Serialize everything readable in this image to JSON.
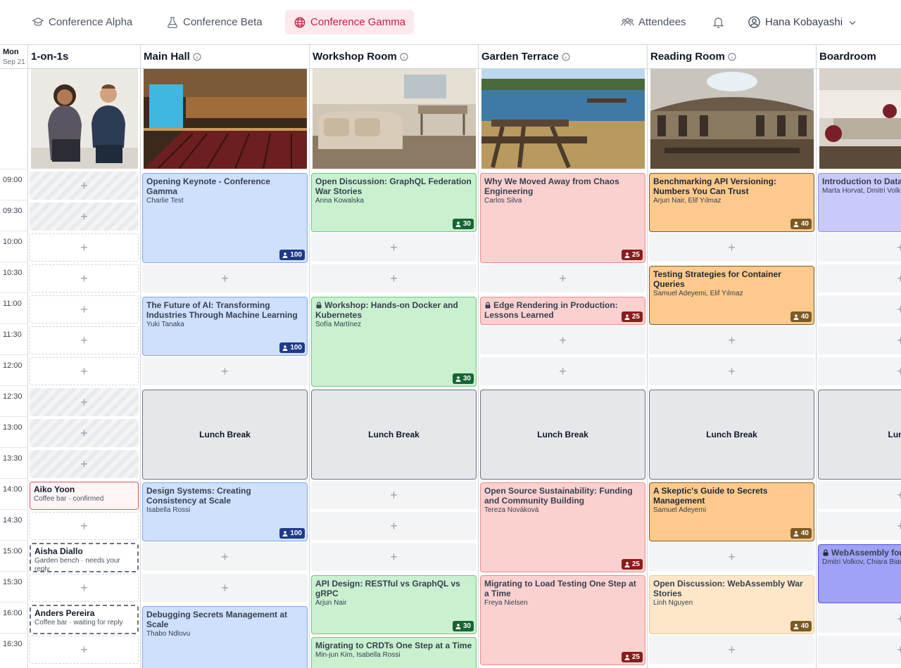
{
  "nav": {
    "tabs": [
      {
        "label": "Conference Alpha",
        "icon": "graduation-cap-icon"
      },
      {
        "label": "Conference Beta",
        "icon": "flask-icon"
      },
      {
        "label": "Conference Gamma",
        "icon": "globe-icon",
        "active": true
      }
    ],
    "attendees_label": "Attendees",
    "user_name": "Hana Kobayashi"
  },
  "date": {
    "dow": "Mon",
    "day": "Sep 21"
  },
  "times": [
    "09:00",
    "09:30",
    "10:00",
    "10:30",
    "11:00",
    "11:30",
    "12:00",
    "12:30",
    "13:00",
    "13:30",
    "14:00",
    "14:30",
    "15:00",
    "15:30",
    "16:00",
    "16:30"
  ],
  "columns": [
    {
      "name": "1-on-1s"
    },
    {
      "name": "Main Hall"
    },
    {
      "name": "Workshop Room"
    },
    {
      "name": "Garden Terrace"
    },
    {
      "name": "Reading Room"
    },
    {
      "name": "Boardroom"
    }
  ],
  "meetings": [
    {
      "name": "Aiko Yoon",
      "detail": "Coffee bar · confirmed"
    },
    {
      "name": "Aisha Diallo",
      "detail": "Garden bench · needs your reply"
    },
    {
      "name": "Anders Pereira",
      "detail": "Coffee bar · waiting for reply"
    }
  ],
  "sessions": {
    "main": [
      {
        "title": "Opening Keynote - Conference Gamma",
        "speakers": "Charlie Test",
        "cap": "100"
      },
      {
        "title": "The Future of AI: Transforming Industries Through Machine Learning",
        "speakers": "Yuki Tanaka",
        "cap": "100"
      },
      {
        "title": "Design Systems: Creating Consistency at Scale",
        "speakers": "Isabella Rossi",
        "cap": "100"
      },
      {
        "title": "Debugging Secrets Management at Scale",
        "speakers": "Thabo Ndlovu"
      }
    ],
    "workshop": [
      {
        "title": "Open Discussion: GraphQL Federation War Stories",
        "speakers": "Anna Kowalska",
        "cap": "30"
      },
      {
        "title": "Workshop: Hands-on Docker and Kubernetes",
        "speakers": "Sofía Martínez",
        "cap": "30"
      },
      {
        "title": "API Design: RESTful vs GraphQL vs gRPC",
        "speakers": "Arjun Nair",
        "cap": "30"
      },
      {
        "title": "Migrating to CRDTs One Step at a Time",
        "speakers": "Min-jun Kim, Isabella Rossi"
      }
    ],
    "garden": [
      {
        "title": "Why We Moved Away from Chaos Engineering",
        "speakers": "Carlos Silva",
        "cap": "25"
      },
      {
        "title": "Edge Rendering in Production: Lessons Learned",
        "cap": "25"
      },
      {
        "title": "Open Source Sustainability: Funding and Community Building",
        "speakers": "Tereza Nováková",
        "cap": "25"
      },
      {
        "title": "Migrating to Load Testing One Step at a Time",
        "speakers": "Freya Nielsen",
        "cap": "25"
      }
    ],
    "reading": [
      {
        "title": "Benchmarking API Versioning: Numbers You Can Trust",
        "speakers": "Arjun Nair, Elif Yılmaz",
        "cap": "40"
      },
      {
        "title": "Testing Strategies for Container Queries",
        "speakers": "Samuel Adeyemi, Elif Yılmaz",
        "cap": "40"
      },
      {
        "title": "A Skeptic's Guide to Secrets Management",
        "speakers": "Samuel Adeyemi",
        "cap": "40"
      },
      {
        "title": "Open Discussion: WebAssembly War Stories",
        "speakers": "Linh Nguyen",
        "cap": "40"
      }
    ],
    "board": [
      {
        "title": "Introduction to Datab",
        "speakers": "Marta Horvat, Dmitri Volk"
      },
      {
        "title": "WebAssembly for",
        "speakers": "Dmitri Volkov, Chiara Bian"
      }
    ]
  },
  "lunch_label": "Lunch Break",
  "lunch_label_cut": "Lunch"
}
